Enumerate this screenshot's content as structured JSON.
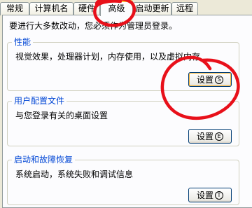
{
  "tabs": [
    {
      "label": "常规"
    },
    {
      "label": "计算机名"
    },
    {
      "label": "硬件"
    },
    {
      "label": "高级"
    },
    {
      "label": "启动更新"
    },
    {
      "label": "远程"
    }
  ],
  "admin_note": "要进行大多数改动，您必须作为管理员登录。",
  "performance": {
    "legend": "性能",
    "description": "视觉效果，处理器计划，内存使用，以及虚拟内存",
    "button_label": "设置",
    "button_key": "S"
  },
  "user_profiles": {
    "legend": "用户配置文件",
    "description": "与您登录有关的桌面设置",
    "button_label": "设置",
    "button_key": "E"
  },
  "startup_recovery": {
    "legend": "启动和故障恢复",
    "description": "系统启动，系统失败和调试信息",
    "button_label": "设置",
    "button_key": "T"
  },
  "annotation_color": "#E8101A"
}
